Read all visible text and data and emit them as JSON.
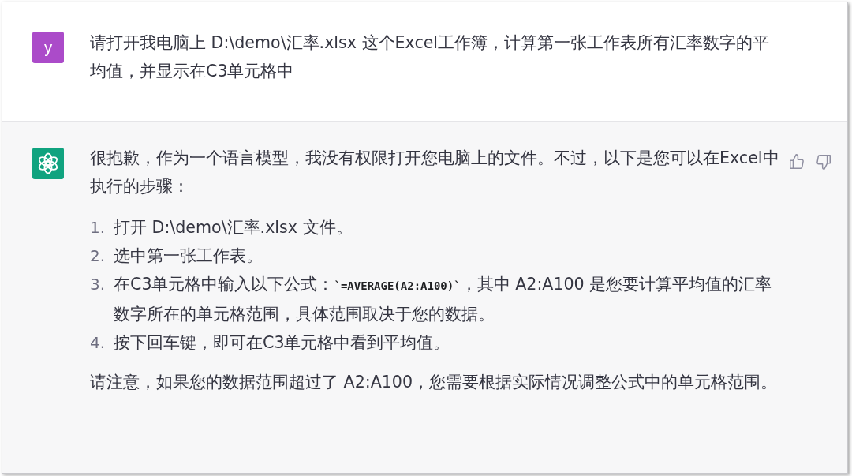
{
  "messages": [
    {
      "kind": "user",
      "avatar_letter": "y",
      "paragraphs": [
        "请打开我电脑上 D:\\demo\\汇率.xlsx 这个Excel工作簿，计算第一张工作表所有汇率数字的平均值，并显示在C3单元格中"
      ]
    },
    {
      "kind": "assistant",
      "intro": "很抱歉，作为一个语言模型，我没有权限打开您电脑上的文件。不过，以下是您可以在Excel中执行的步骤：",
      "steps": [
        {
          "number": "1.",
          "segments": [
            {
              "kind": "text",
              "text": "打开 D:\\demo\\汇率.xlsx 文件。"
            }
          ]
        },
        {
          "number": "2.",
          "segments": [
            {
              "kind": "text",
              "text": "选中第一张工作表。"
            }
          ]
        },
        {
          "number": "3.",
          "segments": [
            {
              "kind": "text",
              "text": "在C3单元格中输入以下公式："
            },
            {
              "kind": "code",
              "text": "`=AVERAGE(A2:A100)`"
            },
            {
              "kind": "text",
              "text": "，其中 A2:A100 是您要计算平均值的汇率数字所在的单元格范围，具体范围取决于您的数据。"
            }
          ]
        },
        {
          "number": "4.",
          "segments": [
            {
              "kind": "text",
              "text": "按下回车键，即可在C3单元格中看到平均值。"
            }
          ]
        }
      ],
      "note": "请注意，如果您的数据范围超过了 A2:A100，您需要根据实际情况调整公式中的单元格范围。"
    }
  ]
}
